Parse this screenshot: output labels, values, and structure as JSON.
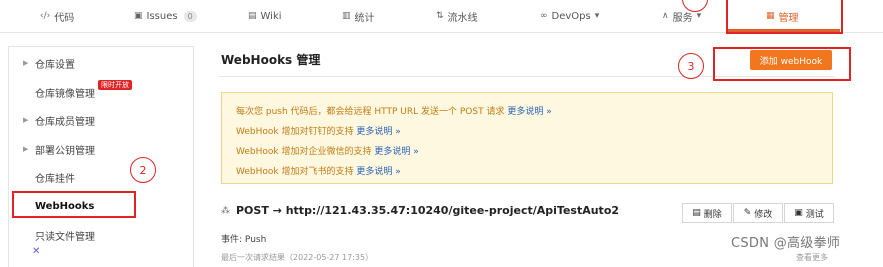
{
  "nav": {
    "tabs": [
      {
        "icon": "code-icon",
        "glyph": "‹/›",
        "label": "代码"
      },
      {
        "icon": "issues-icon",
        "glyph": "▣",
        "label": "Issues",
        "count": "0"
      },
      {
        "icon": "wiki-icon",
        "glyph": "▤",
        "label": "Wiki"
      },
      {
        "icon": "stats-icon",
        "glyph": "▥",
        "label": "统计"
      },
      {
        "icon": "pipeline-icon",
        "glyph": "⇅",
        "label": "流水线"
      },
      {
        "icon": "devops-icon",
        "glyph": "∞",
        "label": "DevOps",
        "caret": "▾"
      },
      {
        "icon": "service-icon",
        "glyph": "∧",
        "label": "服务",
        "caret": "▾"
      },
      {
        "icon": "manage-icon",
        "glyph": "▦",
        "label": "管理"
      }
    ],
    "accent_color": "#e0602b"
  },
  "sidebar": {
    "items": [
      {
        "label": "仓库设置",
        "caret": true
      },
      {
        "label": "仓库镜像管理",
        "caret": false,
        "badge": "限时开放"
      },
      {
        "label": "仓库成员管理",
        "caret": true
      },
      {
        "label": "部署公钥管理",
        "caret": true
      },
      {
        "label": "仓库挂件",
        "caret": false
      },
      {
        "label": "WebHooks",
        "caret": false,
        "selected": true
      },
      {
        "label": "只读文件管理",
        "caret": false
      }
    ]
  },
  "main": {
    "title": "WebHooks 管理",
    "add_button": "添加 webHook",
    "notice": [
      {
        "text": "每次您 push 代码后，都会给远程 HTTP URL 发送一个 POST 请求",
        "more": "更多说明 »"
      },
      {
        "text": "WebHook 增加对钉钉的支持",
        "more": "更多说明 »"
      },
      {
        "text": "WebHook 增加对企业微信的支持",
        "more": "更多说明 »"
      },
      {
        "text": "WebHook 增加对飞书的支持",
        "more": "更多说明 »"
      }
    ],
    "hook": {
      "url": "POST → http://121.43.35.47:10240/gitee-project/ApiTestAuto2",
      "delete": "删除",
      "edit": "修改",
      "test": "测试",
      "event_label": "事件:",
      "event_value": "Push",
      "last_result": "最后一次请求结果（2022-05-27 17:35）",
      "view_more": "查看更多"
    }
  },
  "annotations": {
    "step2": "2",
    "step3": "3"
  },
  "watermark": "CSDN @高级拳师"
}
